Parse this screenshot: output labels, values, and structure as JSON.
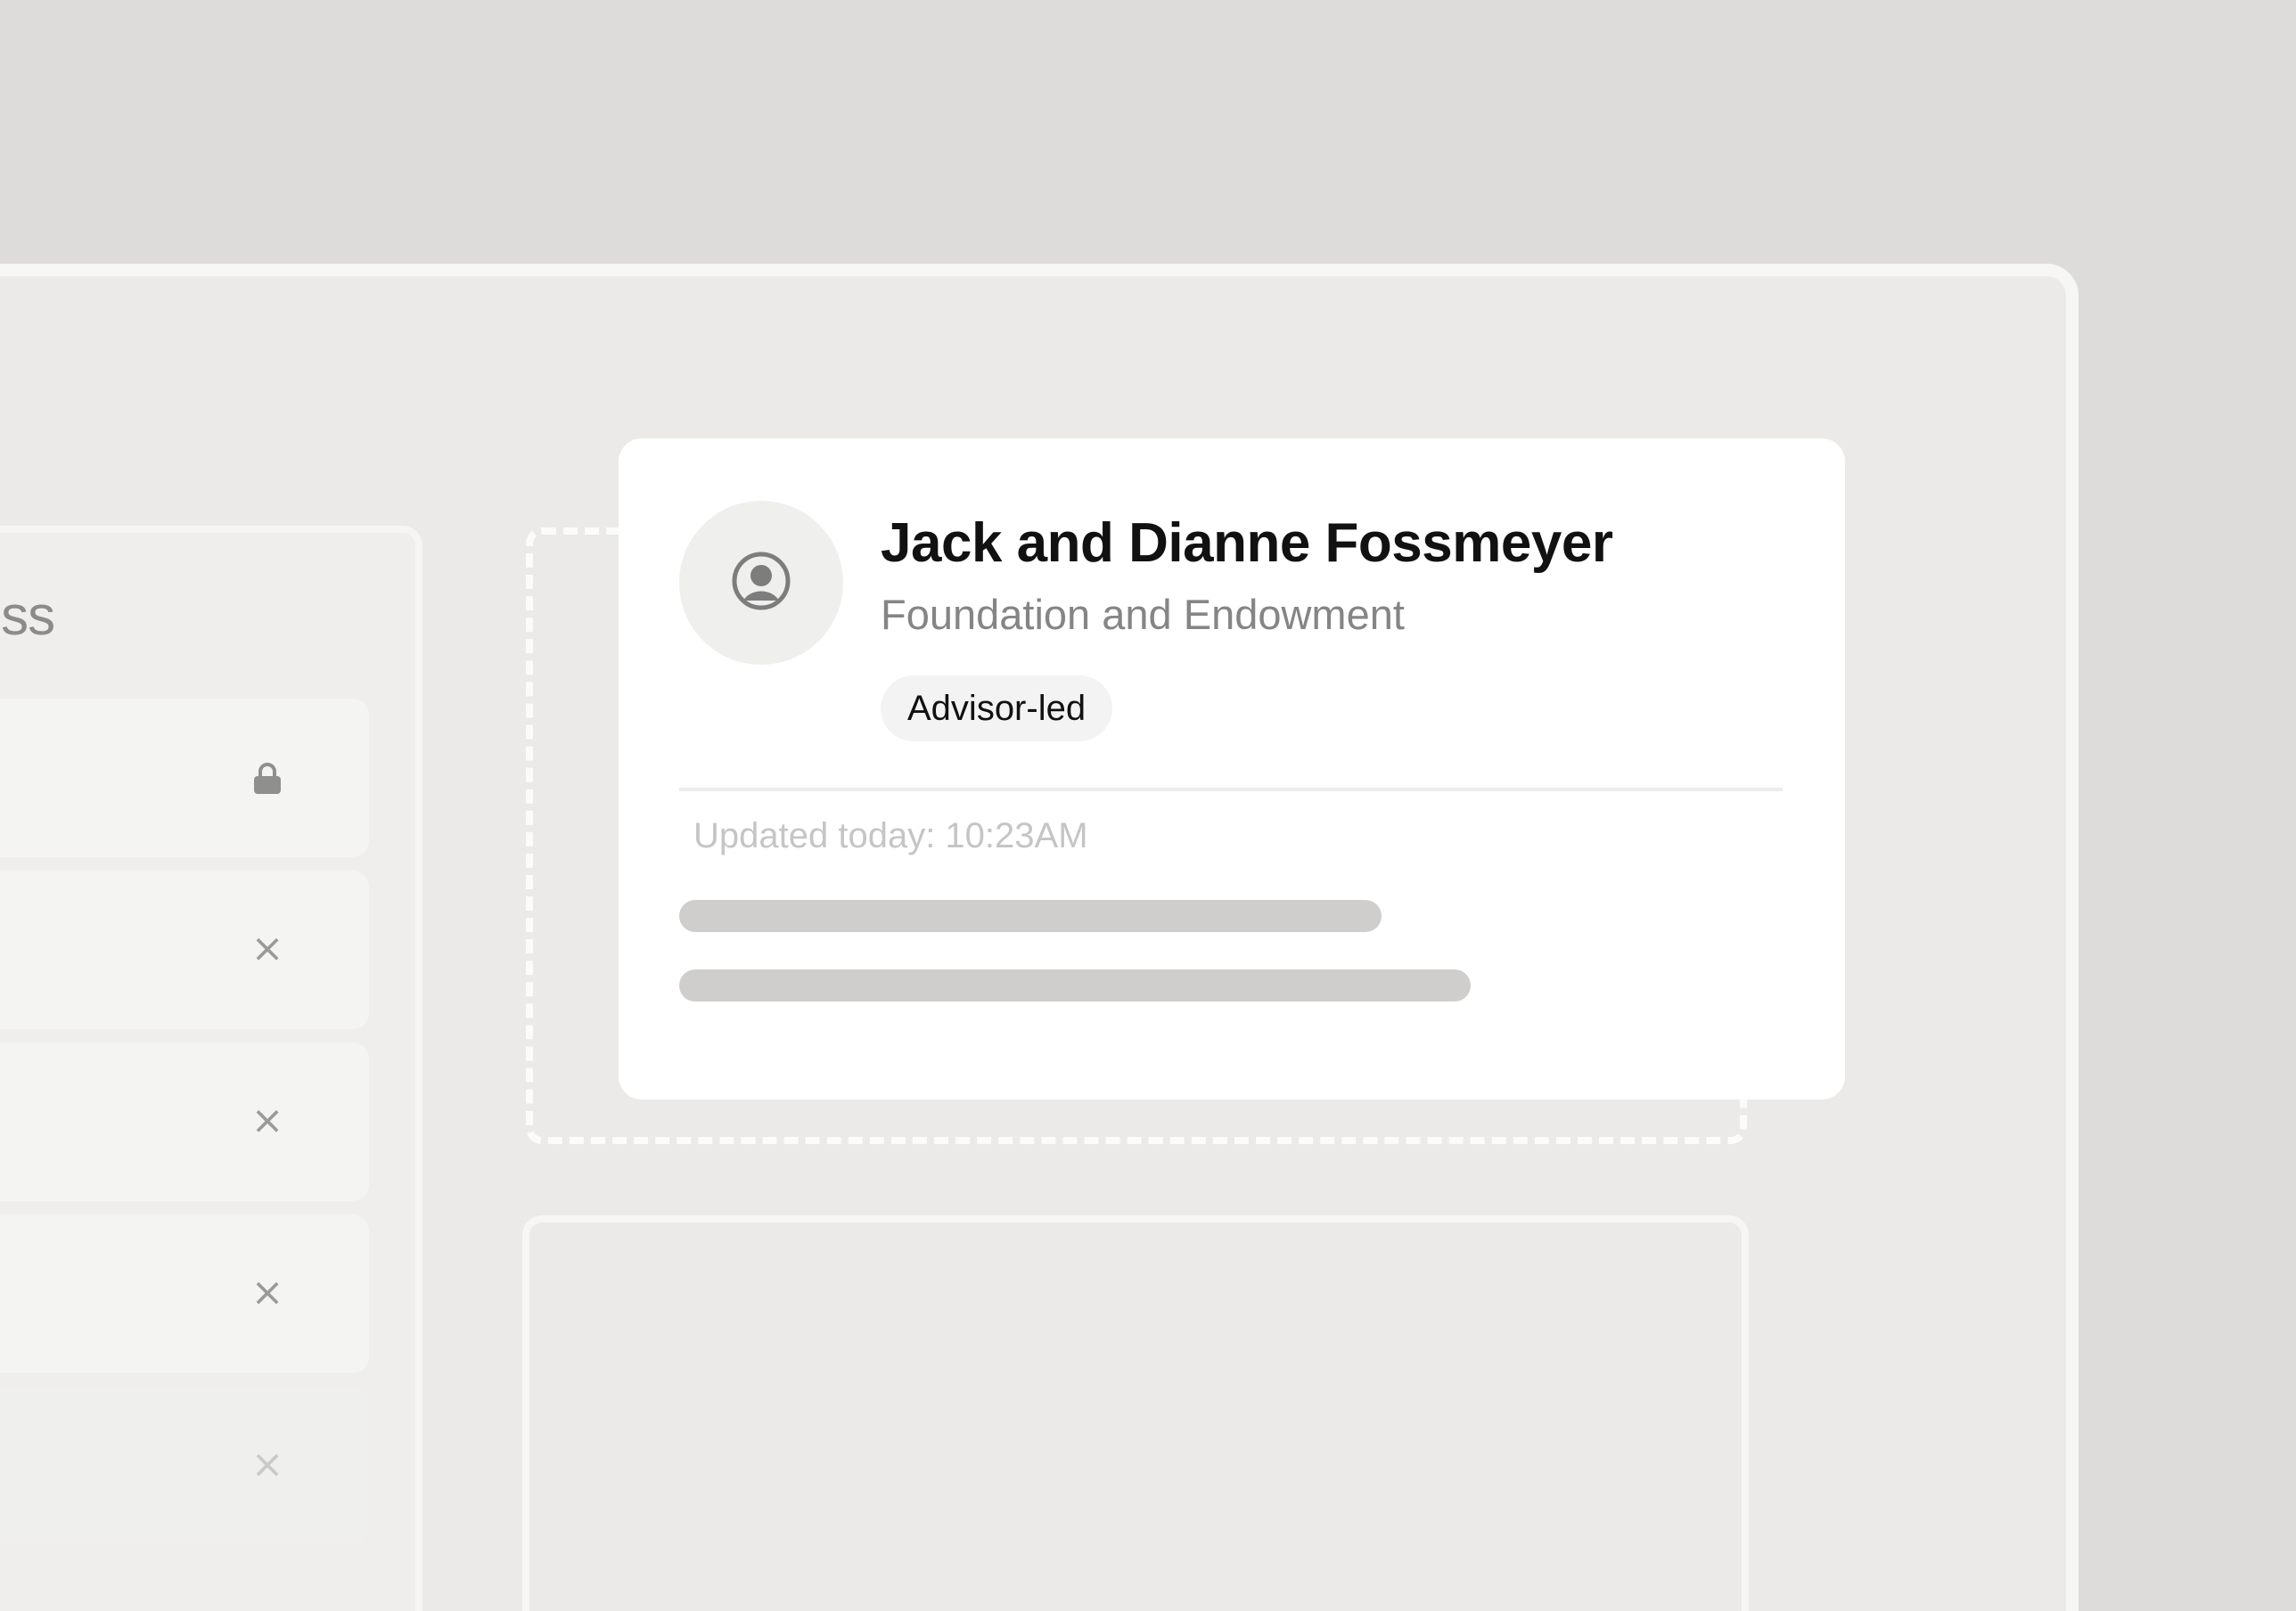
{
  "left_panel": {
    "heading_fragment": "ress",
    "rows": [
      {
        "icon": "lock-icon"
      },
      {
        "icon": "close-icon"
      },
      {
        "icon": "close-icon"
      },
      {
        "icon": "close-icon"
      },
      {
        "icon": "close-icon"
      }
    ]
  },
  "card": {
    "avatar_icon": "user-icon",
    "name": "Jack and Dianne Fossmeyer",
    "organization": "Foundation and Endowment",
    "tag": "Advisor-led",
    "updated": "Updated today: 10:23AM"
  },
  "colors": {
    "background": "#dddcdb",
    "window": "#ebeae8",
    "card": "#ffffff",
    "skeleton": "#cfcecc",
    "muted_text": "#858585"
  }
}
